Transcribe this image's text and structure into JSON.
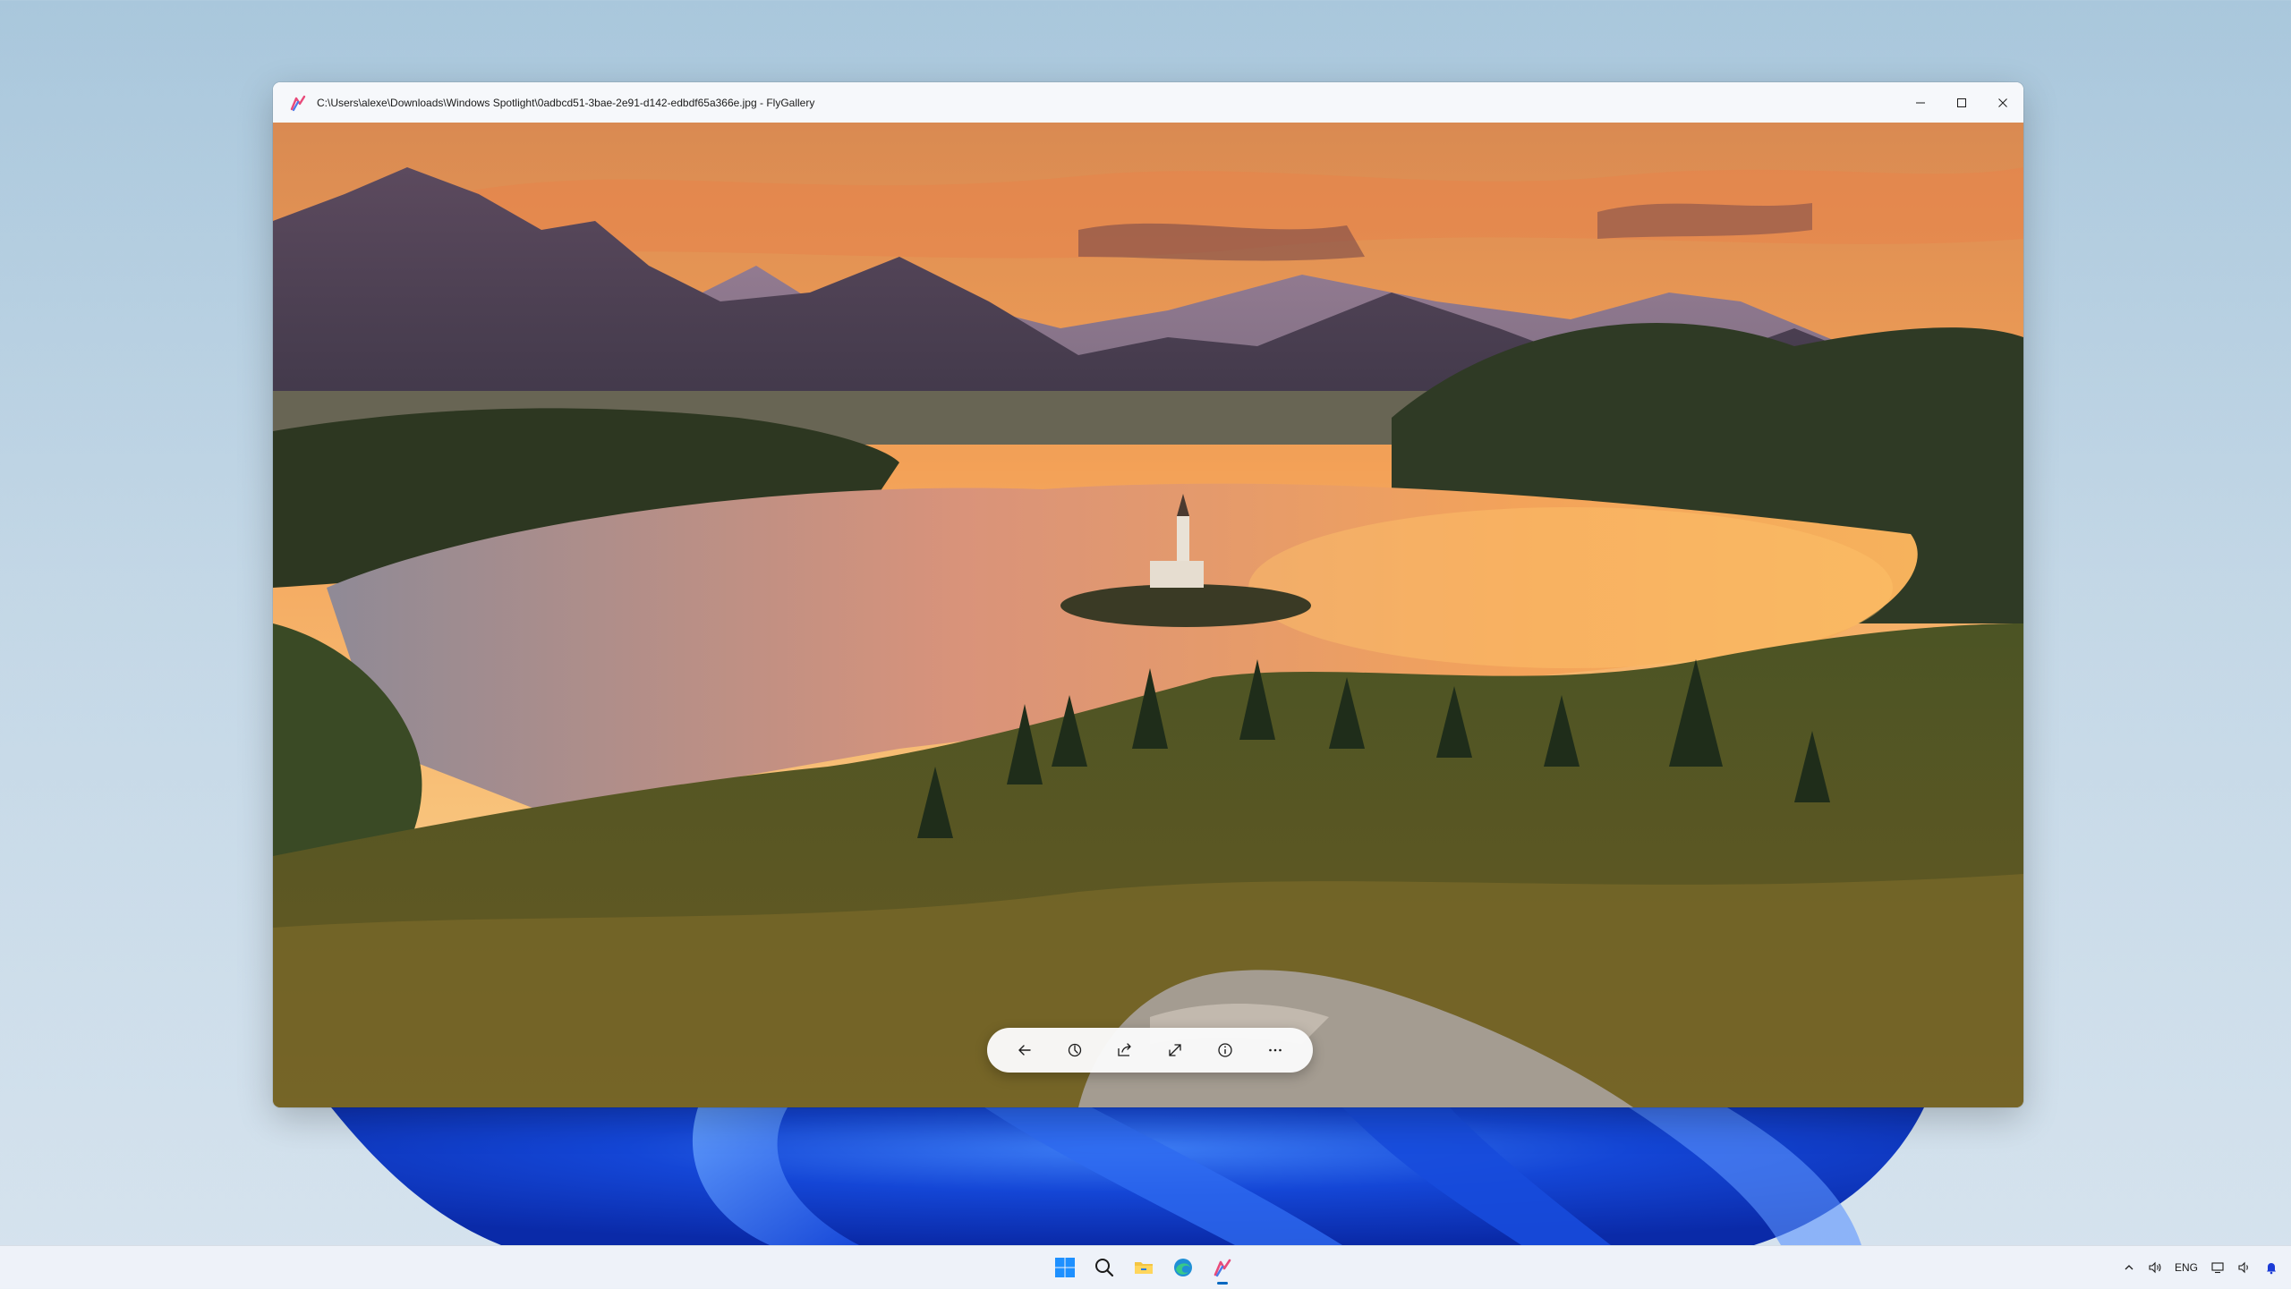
{
  "window": {
    "title": "C:\\Users\\alexe\\Downloads\\Windows Spotlight\\0adbcd51-3bae-2e91-d142-edbdf65a366e.jpg - FlyGallery",
    "icons": [
      "flygallery-app-icon",
      "minimize-icon",
      "maximize-icon",
      "close-icon"
    ]
  },
  "toolbar": {
    "buttons": [
      "back-arrow-icon",
      "edit-icon",
      "share-icon",
      "expand-icon",
      "info-icon",
      "more-icon"
    ]
  },
  "taskbar": {
    "apps": [
      "windows-start-icon",
      "search-icon",
      "file-explorer-icon",
      "edge-icon",
      "flygallery-icon"
    ],
    "tray": {
      "language": "ENG",
      "icons": [
        "chevron-up-icon",
        "volume-icon",
        "network-icon",
        "volume-icon",
        "notification-bell-icon"
      ]
    }
  },
  "colors": {
    "accent": "#0067c0",
    "wallpaper_blue": "#1d4fe0"
  }
}
